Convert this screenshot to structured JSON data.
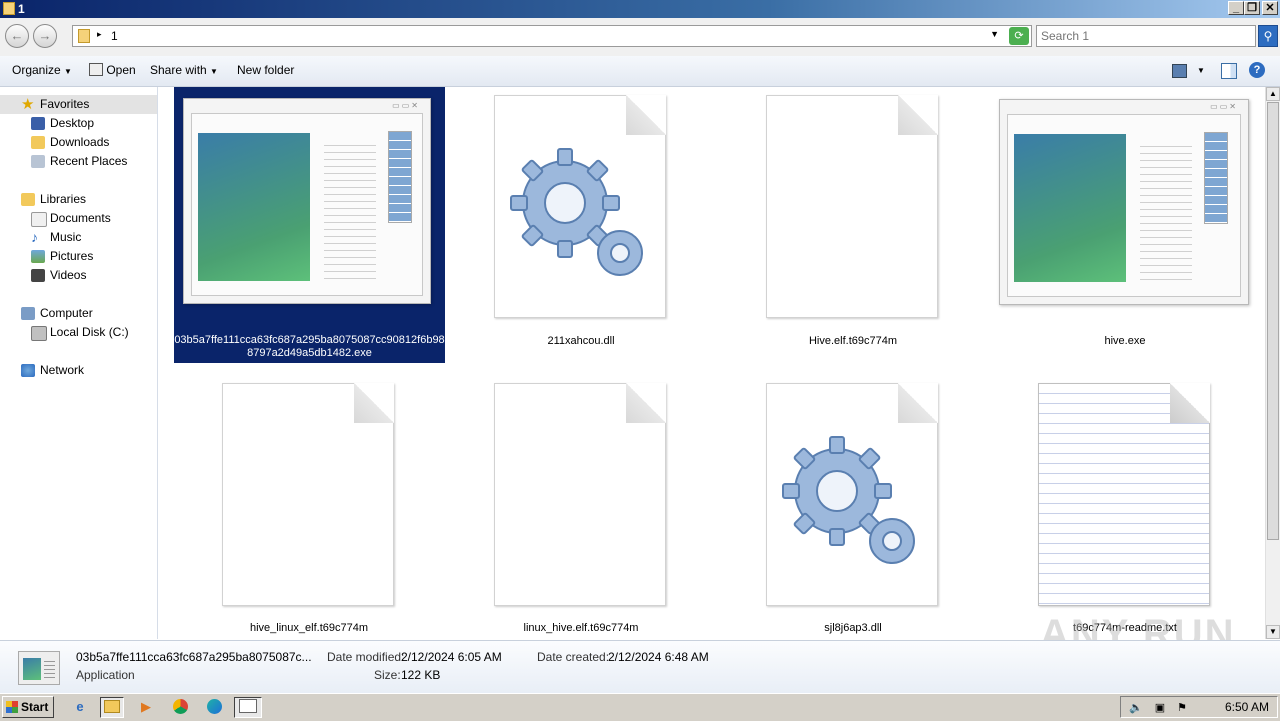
{
  "window": {
    "title": "1"
  },
  "address": {
    "path": "1"
  },
  "search": {
    "placeholder": "Search 1"
  },
  "toolbar": {
    "organize": "Organize",
    "open": "Open",
    "share_with": "Share with",
    "new_folder": "New folder"
  },
  "sidebar": {
    "favorites": "Favorites",
    "desktop": "Desktop",
    "downloads": "Downloads",
    "recent_places": "Recent Places",
    "libraries": "Libraries",
    "documents": "Documents",
    "music": "Music",
    "pictures": "Pictures",
    "videos": "Videos",
    "computer": "Computer",
    "local_disk": "Local Disk (C:)",
    "network": "Network"
  },
  "files": [
    {
      "name": "03b5a7ffe111cca63fc687a295ba8075087cc90812f6b988797a2d49a5db1482.exe",
      "icon": "application-icon"
    },
    {
      "name": "211xahcou.dll",
      "icon": "gears-icon"
    },
    {
      "name": "Hive.elf.t69c774m",
      "icon": "blank-document-icon"
    },
    {
      "name": "hive.exe",
      "icon": "application-icon"
    },
    {
      "name": "hive_linux_elf.t69c774m",
      "icon": "blank-document-icon"
    },
    {
      "name": "linux_hive.elf.t69c774m",
      "icon": "blank-document-icon"
    },
    {
      "name": "sjl8j6ap3.dll",
      "icon": "gears-icon"
    },
    {
      "name": "t69c774m-readme.txt",
      "icon": "text-document-icon"
    }
  ],
  "details": {
    "name": "03b5a7ffe111cca63fc687a295ba8075087c...",
    "type": "Application",
    "modified_label": "Date modified:",
    "modified_value": "2/12/2024 6:05 AM",
    "created_label": "Date created:",
    "created_value": "2/12/2024 6:48 AM",
    "size_label": "Size:",
    "size_value": "122 KB"
  },
  "taskbar": {
    "start": "Start",
    "clock": "6:50 AM"
  },
  "watermark": "ANY RUN"
}
